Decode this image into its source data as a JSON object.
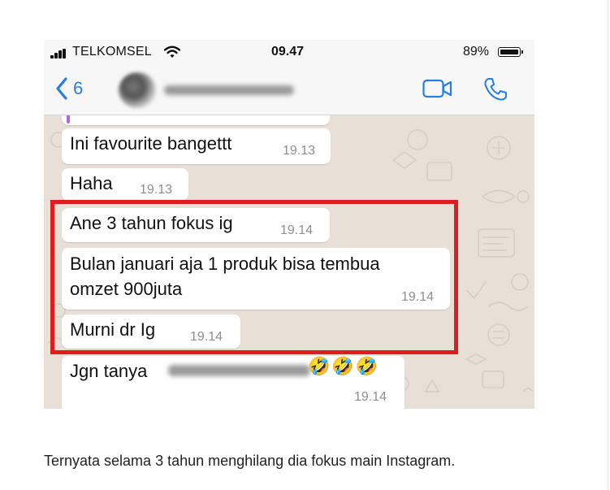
{
  "status_bar": {
    "carrier": "TELKOMSEL",
    "time": "09.47",
    "battery": "89%"
  },
  "nav": {
    "back_count": "6",
    "contact_name": "",
    "accent_color": "#2a7de1"
  },
  "messages": [
    {
      "text": "Ini favourite bangettt",
      "time": "19.13"
    },
    {
      "text": "Haha",
      "time": "19.13"
    },
    {
      "text": "Ane 3 tahun fokus ig",
      "time": "19.14"
    },
    {
      "text_line1": "Bulan januari aja 1 produk bisa tembua",
      "text_line2": "omzet 900juta",
      "time": "19.14"
    },
    {
      "text": "Murni dr Ig",
      "time": "19.14"
    },
    {
      "text": "Jgn tanya",
      "emoji": "🤣🤣🤣",
      "time": "19.14"
    }
  ],
  "highlight_color": "#e21b1b",
  "caption": "Ternyata selama 3 tahun menghilang dia fokus main Instagram."
}
